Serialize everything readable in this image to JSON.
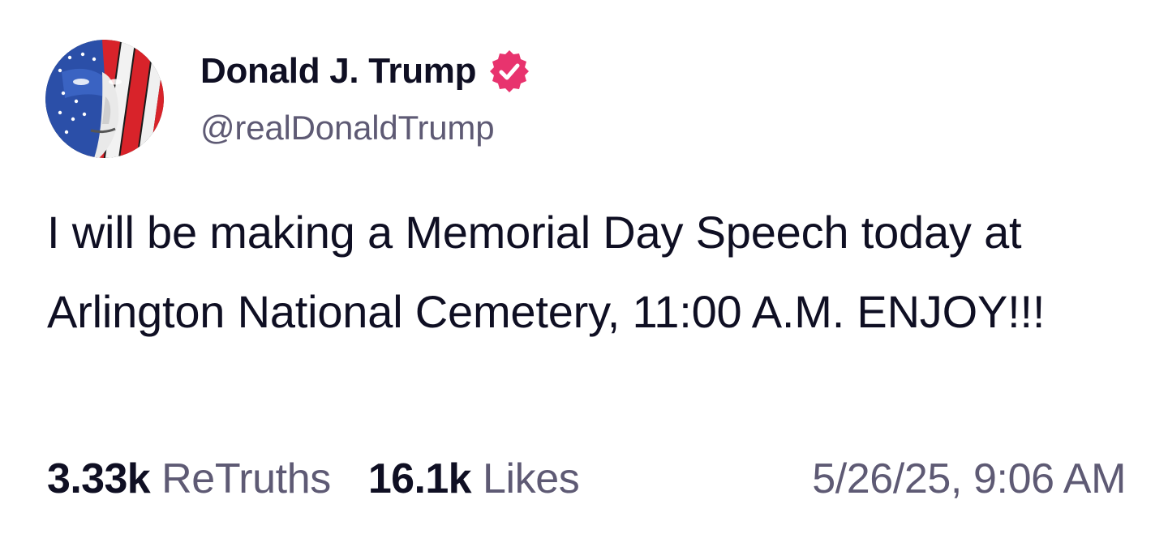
{
  "author": {
    "display_name": "Donald J. Trump",
    "handle": "@realDonaldTrump",
    "verified": true,
    "verified_badge_icon": "verified-badge-icon",
    "verified_badge_color": "#e8336e",
    "avatar_icon": "avatar-flag-portrait"
  },
  "post": {
    "text": "I will be making a Memorial Day Speech today at Arlington National Cemetery, 11:00 A.M. ENJOY!!!"
  },
  "stats": {
    "retruths_count": "3.33k",
    "retruths_label": "ReTruths",
    "likes_count": "16.1k",
    "likes_label": "Likes",
    "timestamp": "5/26/25, 9:06 AM"
  },
  "colors": {
    "text_primary": "#0f0f23",
    "text_secondary": "#5e5a74",
    "background": "#ffffff"
  }
}
